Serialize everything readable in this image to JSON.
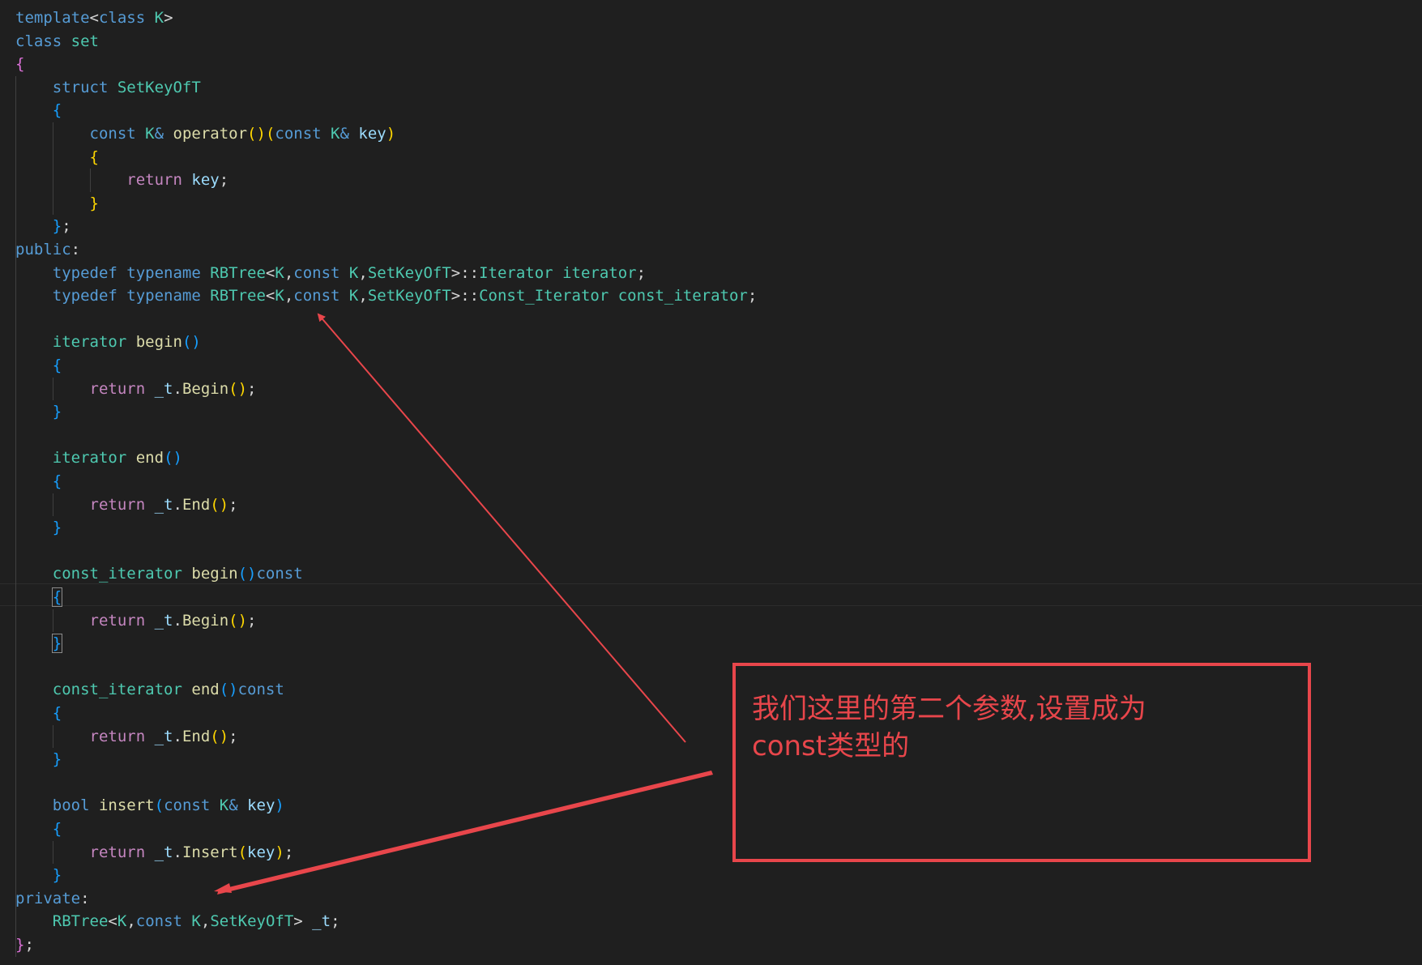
{
  "code": {
    "lines": [
      [
        [
          "kw",
          "template"
        ],
        [
          "punc",
          "<"
        ],
        [
          "kw",
          "class"
        ],
        [
          "punc",
          " "
        ],
        [
          "type",
          "K"
        ],
        [
          "punc",
          ">"
        ]
      ],
      [
        [
          "kw",
          "class"
        ],
        [
          "punc",
          " "
        ],
        [
          "type",
          "set"
        ]
      ],
      [
        [
          "br2",
          "{"
        ]
      ],
      [
        [
          "punc",
          "    "
        ],
        [
          "kw",
          "struct"
        ],
        [
          "punc",
          " "
        ],
        [
          "type",
          "SetKeyOfT"
        ]
      ],
      [
        [
          "punc",
          "    "
        ],
        [
          "br3",
          "{"
        ]
      ],
      [
        [
          "punc",
          "        "
        ],
        [
          "kw",
          "const"
        ],
        [
          "punc",
          " "
        ],
        [
          "type",
          "K"
        ],
        [
          "kw",
          "&"
        ],
        [
          "punc",
          " "
        ],
        [
          "fn",
          "operator"
        ],
        [
          "br1",
          "()"
        ],
        [
          "br1",
          "("
        ],
        [
          "kw",
          "const"
        ],
        [
          "punc",
          " "
        ],
        [
          "type",
          "K"
        ],
        [
          "kw",
          "&"
        ],
        [
          "punc",
          " "
        ],
        [
          "var",
          "key"
        ],
        [
          "br1",
          ")"
        ]
      ],
      [
        [
          "punc",
          "        "
        ],
        [
          "br1",
          "{"
        ]
      ],
      [
        [
          "punc",
          "            "
        ],
        [
          "ctl",
          "return"
        ],
        [
          "punc",
          " "
        ],
        [
          "var",
          "key"
        ],
        [
          "punc",
          ";"
        ]
      ],
      [
        [
          "punc",
          "        "
        ],
        [
          "br1",
          "}"
        ]
      ],
      [
        [
          "punc",
          "    "
        ],
        [
          "br3",
          "}"
        ],
        [
          "punc",
          ";"
        ]
      ],
      [
        [
          "kw",
          "public"
        ],
        [
          "punc",
          ":"
        ]
      ],
      [
        [
          "punc",
          "    "
        ],
        [
          "kw",
          "typedef"
        ],
        [
          "punc",
          " "
        ],
        [
          "kw",
          "typename"
        ],
        [
          "punc",
          " "
        ],
        [
          "type",
          "RBTree"
        ],
        [
          "punc",
          "<"
        ],
        [
          "type",
          "K"
        ],
        [
          "punc",
          ","
        ],
        [
          "kw",
          "const"
        ],
        [
          "punc",
          " "
        ],
        [
          "type",
          "K"
        ],
        [
          "punc",
          ","
        ],
        [
          "type",
          "SetKeyOfT"
        ],
        [
          "punc",
          ">::"
        ],
        [
          "type",
          "Iterator"
        ],
        [
          "punc",
          " "
        ],
        [
          "type",
          "iterator"
        ],
        [
          "punc",
          ";"
        ]
      ],
      [
        [
          "punc",
          "    "
        ],
        [
          "kw",
          "typedef"
        ],
        [
          "punc",
          " "
        ],
        [
          "kw",
          "typename"
        ],
        [
          "punc",
          " "
        ],
        [
          "type",
          "RBTree"
        ],
        [
          "punc",
          "<"
        ],
        [
          "type",
          "K"
        ],
        [
          "punc",
          ","
        ],
        [
          "kw",
          "const"
        ],
        [
          "punc",
          " "
        ],
        [
          "type",
          "K"
        ],
        [
          "punc",
          ","
        ],
        [
          "type",
          "SetKeyOfT"
        ],
        [
          "punc",
          ">::"
        ],
        [
          "type",
          "Const_Iterator"
        ],
        [
          "punc",
          " "
        ],
        [
          "type",
          "const_iterator"
        ],
        [
          "punc",
          ";"
        ]
      ],
      [],
      [
        [
          "punc",
          "    "
        ],
        [
          "type",
          "iterator"
        ],
        [
          "punc",
          " "
        ],
        [
          "fn",
          "begin"
        ],
        [
          "br3",
          "()"
        ]
      ],
      [
        [
          "punc",
          "    "
        ],
        [
          "br3",
          "{"
        ]
      ],
      [
        [
          "punc",
          "        "
        ],
        [
          "ctl",
          "return"
        ],
        [
          "punc",
          " "
        ],
        [
          "var",
          "_t"
        ],
        [
          "punc",
          "."
        ],
        [
          "fn",
          "Begin"
        ],
        [
          "br1",
          "()"
        ],
        [
          "punc",
          ";"
        ]
      ],
      [
        [
          "punc",
          "    "
        ],
        [
          "br3",
          "}"
        ]
      ],
      [],
      [
        [
          "punc",
          "    "
        ],
        [
          "type",
          "iterator"
        ],
        [
          "punc",
          " "
        ],
        [
          "fn",
          "end"
        ],
        [
          "br3",
          "()"
        ]
      ],
      [
        [
          "punc",
          "    "
        ],
        [
          "br3",
          "{"
        ]
      ],
      [
        [
          "punc",
          "        "
        ],
        [
          "ctl",
          "return"
        ],
        [
          "punc",
          " "
        ],
        [
          "var",
          "_t"
        ],
        [
          "punc",
          "."
        ],
        [
          "fn",
          "End"
        ],
        [
          "br1",
          "()"
        ],
        [
          "punc",
          ";"
        ]
      ],
      [
        [
          "punc",
          "    "
        ],
        [
          "br3",
          "}"
        ]
      ],
      [],
      [
        [
          "punc",
          "    "
        ],
        [
          "type",
          "const_iterator"
        ],
        [
          "punc",
          " "
        ],
        [
          "fn",
          "begin"
        ],
        [
          "br3",
          "()"
        ],
        [
          "kw",
          "const"
        ]
      ],
      [
        [
          "punc",
          "    "
        ],
        [
          "br3m",
          "{"
        ]
      ],
      [
        [
          "punc",
          "        "
        ],
        [
          "ctl",
          "return"
        ],
        [
          "punc",
          " "
        ],
        [
          "var",
          "_t"
        ],
        [
          "punc",
          "."
        ],
        [
          "fn",
          "Begin"
        ],
        [
          "br1",
          "()"
        ],
        [
          "punc",
          ";"
        ]
      ],
      [
        [
          "punc",
          "    "
        ],
        [
          "br3m",
          "}"
        ]
      ],
      [],
      [
        [
          "punc",
          "    "
        ],
        [
          "type",
          "const_iterator"
        ],
        [
          "punc",
          " "
        ],
        [
          "fn",
          "end"
        ],
        [
          "br3",
          "()"
        ],
        [
          "kw",
          "const"
        ]
      ],
      [
        [
          "punc",
          "    "
        ],
        [
          "br3",
          "{"
        ]
      ],
      [
        [
          "punc",
          "        "
        ],
        [
          "ctl",
          "return"
        ],
        [
          "punc",
          " "
        ],
        [
          "var",
          "_t"
        ],
        [
          "punc",
          "."
        ],
        [
          "fn",
          "End"
        ],
        [
          "br1",
          "()"
        ],
        [
          "punc",
          ";"
        ]
      ],
      [
        [
          "punc",
          "    "
        ],
        [
          "br3",
          "}"
        ]
      ],
      [],
      [
        [
          "punc",
          "    "
        ],
        [
          "kw",
          "bool"
        ],
        [
          "punc",
          " "
        ],
        [
          "fn",
          "insert"
        ],
        [
          "br3",
          "("
        ],
        [
          "kw",
          "const"
        ],
        [
          "punc",
          " "
        ],
        [
          "type",
          "K"
        ],
        [
          "kw",
          "&"
        ],
        [
          "punc",
          " "
        ],
        [
          "var",
          "key"
        ],
        [
          "br3",
          ")"
        ]
      ],
      [
        [
          "punc",
          "    "
        ],
        [
          "br3",
          "{"
        ]
      ],
      [
        [
          "punc",
          "        "
        ],
        [
          "ctl",
          "return"
        ],
        [
          "punc",
          " "
        ],
        [
          "var",
          "_t"
        ],
        [
          "punc",
          "."
        ],
        [
          "fn",
          "Insert"
        ],
        [
          "br1",
          "("
        ],
        [
          "var",
          "key"
        ],
        [
          "br1",
          ")"
        ],
        [
          "punc",
          ";"
        ]
      ],
      [
        [
          "punc",
          "    "
        ],
        [
          "br3",
          "}"
        ]
      ],
      [
        [
          "kw",
          "private"
        ],
        [
          "punc",
          ":"
        ]
      ],
      [
        [
          "punc",
          "    "
        ],
        [
          "type",
          "RBTree"
        ],
        [
          "punc",
          "<"
        ],
        [
          "type",
          "K"
        ],
        [
          "punc",
          ","
        ],
        [
          "kw",
          "const"
        ],
        [
          "punc",
          " "
        ],
        [
          "type",
          "K"
        ],
        [
          "punc",
          ","
        ],
        [
          "type",
          "SetKeyOfT"
        ],
        [
          "punc",
          "> "
        ],
        [
          "var",
          "_t"
        ],
        [
          "punc",
          ";"
        ]
      ],
      [
        [
          "br2",
          "}"
        ],
        [
          "punc",
          ";"
        ]
      ]
    ]
  },
  "annotation": {
    "text_line1": "我们这里的第二个参数,设置成为",
    "text_line2": "const类型的"
  },
  "colors": {
    "annotation": "#e8464b",
    "background": "#1f1f1f"
  }
}
